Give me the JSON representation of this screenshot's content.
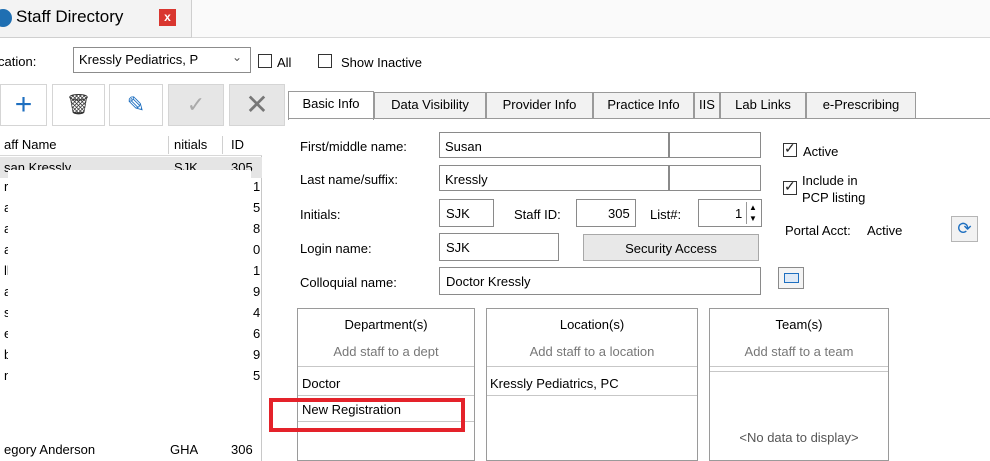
{
  "window": {
    "title": "Staff Directory",
    "close_label": "x"
  },
  "location_bar": {
    "label": "cation:",
    "selected": "Kressly Pediatrics, P",
    "all_label": "All",
    "show_inactive_label": "Show Inactive"
  },
  "toolbar": {
    "add": "+",
    "delete": "🗑",
    "edit": "✎",
    "accept": "✓",
    "cancel": "✕"
  },
  "grid": {
    "headers": {
      "name": "aff Name",
      "initials": "nitials",
      "id": "ID"
    },
    "rows": [
      {
        "name": "san Kressly",
        "initials": "SJK",
        "id": "305"
      },
      {
        "name": "re",
        "initials": "",
        "id": "1"
      },
      {
        "name": "ar",
        "initials": "",
        "id": "5"
      },
      {
        "name": "ari",
        "initials": "",
        "id": "8"
      },
      {
        "name": "ar",
        "initials": "",
        "id": "0"
      },
      {
        "name": "ll",
        "initials": "",
        "id": "1"
      },
      {
        "name": "a",
        "initials": "",
        "id": "9"
      },
      {
        "name": "si",
        "initials": "",
        "id": "4"
      },
      {
        "name": "er",
        "initials": "",
        "id": "6"
      },
      {
        "name": "b",
        "initials": "",
        "id": "9"
      },
      {
        "name": "nr",
        "initials": "",
        "id": "5"
      },
      {
        "name": "egory Anderson",
        "initials": "GHA",
        "id": "306"
      }
    ]
  },
  "tabs": [
    "Basic Info",
    "Data Visibility",
    "Provider Info",
    "Practice Info",
    "IIS",
    "Lab Links",
    "e-Prescribing"
  ],
  "form": {
    "first_name_label": "First/middle name:",
    "first_name_value": "Susan",
    "last_name_label": "Last name/suffix:",
    "last_name_value": "Kressly",
    "initials_label": "Initials:",
    "initials_value": "SJK",
    "staff_id_label": "Staff ID:",
    "staff_id_value": "305",
    "list_label": "List#:",
    "list_value": "1",
    "login_label": "Login name:",
    "login_value": "SJK",
    "security_button": "Security Access",
    "colloquial_label": "Colloquial name:",
    "colloquial_value": "Doctor Kressly",
    "active_label": "Active",
    "pcp_label_1": "Include in",
    "pcp_label_2": "PCP listing",
    "portal_label": "Portal Acct:",
    "portal_value": "Active"
  },
  "panels": {
    "departments": {
      "header": "Department(s)",
      "placeholder": "Add staff to a dept",
      "items": [
        "Doctor",
        "New Registration"
      ]
    },
    "locations": {
      "header": "Location(s)",
      "placeholder": "Add staff to a location",
      "items": [
        "Kressly Pediatrics, PC"
      ]
    },
    "teams": {
      "header": "Team(s)",
      "placeholder": "Add staff to a team",
      "empty": "<No data to display>"
    }
  }
}
